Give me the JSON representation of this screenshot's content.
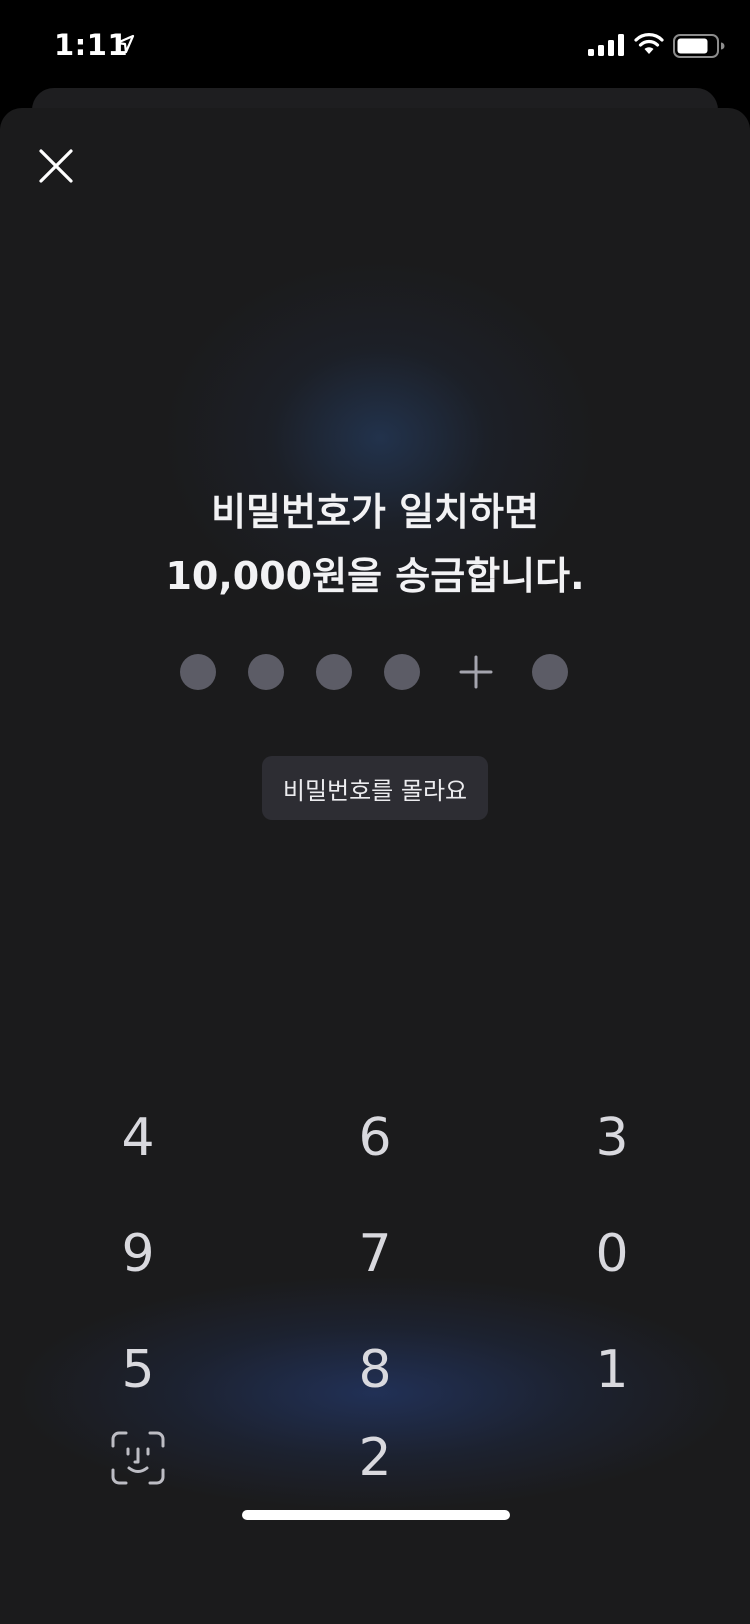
{
  "status_bar": {
    "time": "1:11",
    "icons": [
      "location-arrow-icon",
      "cellular-signal-icon",
      "wifi-icon",
      "battery-icon"
    ]
  },
  "sheet": {
    "close_icon": "close-icon",
    "title_line1": "비밀번호가 일치하면",
    "title_line2": "10,000원을 송금합니다.",
    "pin": {
      "filled_slots": 6,
      "slots": [
        "dot",
        "dot",
        "dot",
        "dot",
        "plus",
        "dot"
      ]
    },
    "forgot_label": "비밀번호를 몰라요",
    "keypad": [
      [
        "4",
        "6",
        "3"
      ],
      [
        "9",
        "7",
        "0"
      ],
      [
        "5",
        "8",
        "1"
      ],
      [
        "faceid",
        "2",
        ""
      ]
    ]
  },
  "colors": {
    "background": "#000000",
    "sheet": "#1b1b1c",
    "pin_dot": "#5c5c66",
    "button": "#2d2d33",
    "key_text": "#d9d9de",
    "glow": "#223460"
  }
}
